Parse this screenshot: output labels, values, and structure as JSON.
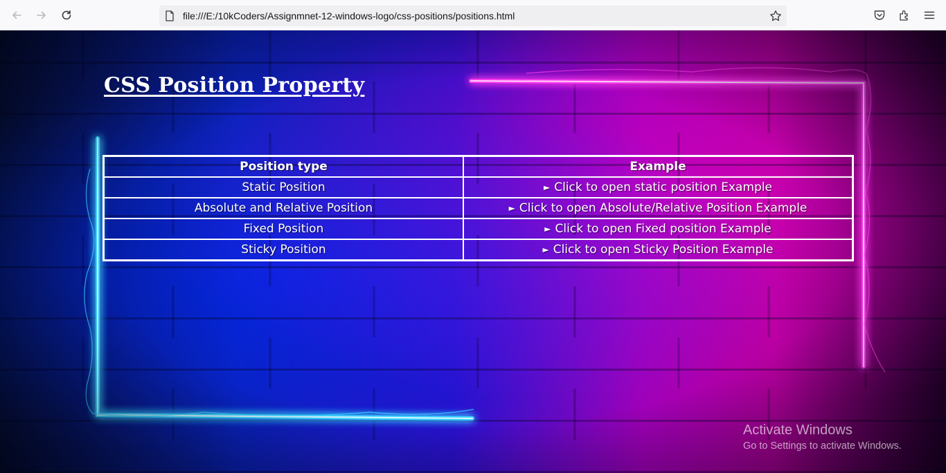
{
  "browser": {
    "url": "file:///E:/10kCoders/Assignmnet-12-windows-logo/css-positions/positions.html",
    "icons": [
      "back-icon",
      "forward-icon",
      "reload-icon",
      "page-icon",
      "bookmark-star-icon",
      "pocket-icon",
      "extensions-icon",
      "menu-icon"
    ]
  },
  "page": {
    "title": "CSS Position Property",
    "table": {
      "headers": [
        "Position type",
        "Example"
      ],
      "rows": [
        {
          "type": "Static Position",
          "example": "Click to open static position Example"
        },
        {
          "type": "Absolute and Relative Position",
          "example": "Click to open Absolute/Relative Position Example"
        },
        {
          "type": "Fixed Position",
          "example": "Click to open Fixed position Example"
        },
        {
          "type": "Sticky Position",
          "example": "Click to open Sticky Position Example"
        }
      ]
    },
    "disclosure_glyph": "►"
  },
  "watermark": {
    "line1": "Activate Windows",
    "line2": "Go to Settings to activate Windows."
  },
  "colors": {
    "neon_blue": "#3ad4ff",
    "neon_pink": "#ff3cf0",
    "text": "#ffffff"
  }
}
